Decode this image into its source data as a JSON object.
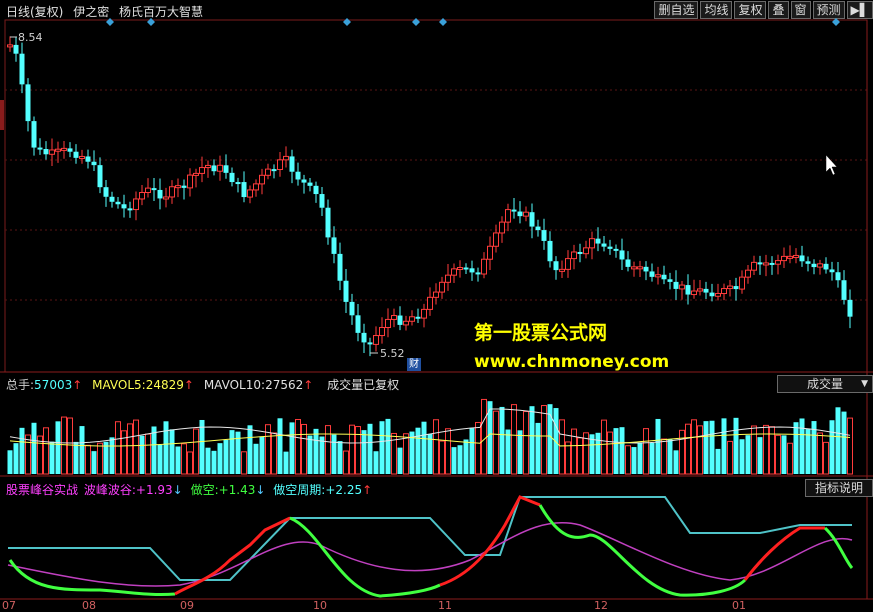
{
  "title": {
    "period": "日线(复权)",
    "formula": "伊之密",
    "indicator": "杨氏百万大智慧"
  },
  "toolbar": {
    "items": [
      "删自选",
      "均线",
      "复权",
      "叠",
      "窗",
      "预测",
      "▶▌"
    ]
  },
  "price_labels": {
    "high": "8.54",
    "low": "5.52"
  },
  "caibao_badge": "财",
  "volume_info": {
    "total_label": "总手:",
    "total_value": "57003",
    "ma5_label": "MAVOL5:",
    "ma5_value": "24829",
    "ma10_label": "MAVOL10:",
    "ma10_value": "27562",
    "note": "成交量已复权",
    "button": "成交量"
  },
  "indicator_info": {
    "name": "股票峰谷实战",
    "l1": "波峰波谷:",
    "v1": "+1.93",
    "l2": "做空:",
    "v2": "+1.43",
    "l3": "做空周期:",
    "v3": "+2.25",
    "button": "指标说明"
  },
  "watermark": {
    "line1": "第一股票公式网",
    "line2": "www.chnmoney.com"
  },
  "x_labels": [
    "07",
    "08",
    "09",
    "10",
    "11",
    "12",
    "01"
  ],
  "colors": {
    "up": "#ff3c3c",
    "down": "#54ffff",
    "text_cyan": "#54ffff",
    "text_yellow": "#ffff54",
    "magenta": "#ff40ff",
    "green": "#40ff40",
    "arrow_red": "#ff3c3c",
    "arrow_blue": "#54c8ff"
  },
  "icons": {
    "diamond": "diamond-marker-icon",
    "cursor": "mouse-cursor-icon"
  }
}
